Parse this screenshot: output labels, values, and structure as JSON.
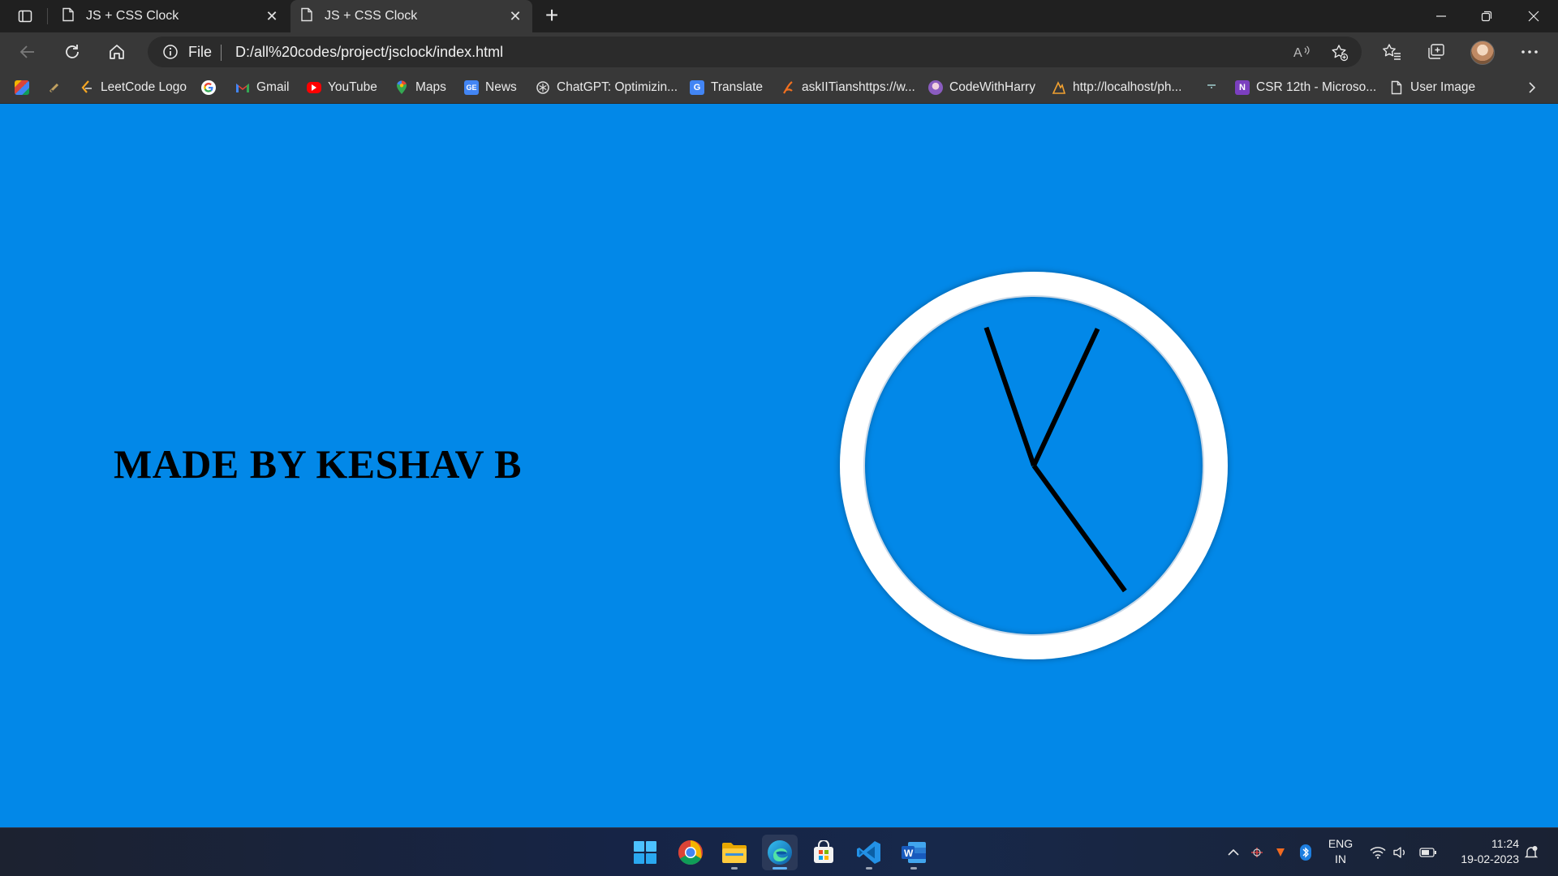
{
  "browser": {
    "tabs": [
      {
        "label": "JS + CSS Clock",
        "active": false
      },
      {
        "label": "JS + CSS Clock",
        "active": true
      }
    ],
    "address": {
      "scheme_label": "File",
      "url": "D:/all%20codes/project/jsclock/index.html"
    },
    "bookmarks": [
      {
        "label": "",
        "icon": "photos-icon"
      },
      {
        "label": "",
        "icon": "pen-icon"
      },
      {
        "label": "LeetCode Logo",
        "icon": "leetcode-icon"
      },
      {
        "label": "",
        "icon": "google-icon"
      },
      {
        "label": "Gmail",
        "icon": "gmail-icon"
      },
      {
        "label": "YouTube",
        "icon": "youtube-icon"
      },
      {
        "label": "Maps",
        "icon": "maps-icon"
      },
      {
        "label": "News",
        "icon": "news-icon"
      },
      {
        "label": "ChatGPT: Optimizin...",
        "icon": "chatgpt-icon"
      },
      {
        "label": "Translate",
        "icon": "translate-icon"
      },
      {
        "label": "askIITianshttps://w...",
        "icon": "askiitians-icon"
      },
      {
        "label": "CodeWithHarry",
        "icon": "codewithharry-icon"
      },
      {
        "label": "http://localhost/ph...",
        "icon": "xampp-icon"
      },
      {
        "label": "",
        "icon": "bookmark-icon"
      },
      {
        "label": "CSR 12th - Microso...",
        "icon": "onenote-icon"
      },
      {
        "label": "User Image",
        "icon": "document-icon"
      }
    ]
  },
  "page": {
    "heading": "MADE BY KESHAV B",
    "clock": {
      "hour_hand_angle_deg": 25,
      "minute_hand_angle_deg": -19,
      "second_hand_angle_deg": 144,
      "colors": {
        "background": "#0288e8",
        "rim": "#ffffff",
        "hands": "#000000"
      }
    }
  },
  "taskbar": {
    "apps": [
      {
        "name": "start",
        "icon": "windows-start-icon"
      },
      {
        "name": "chrome",
        "icon": "chrome-icon"
      },
      {
        "name": "file-explorer",
        "icon": "folder-icon"
      },
      {
        "name": "edge",
        "icon": "edge-icon"
      },
      {
        "name": "microsoft-store",
        "icon": "store-icon"
      },
      {
        "name": "vscode",
        "icon": "vscode-icon"
      },
      {
        "name": "word",
        "icon": "word-icon"
      }
    ],
    "tray": {
      "language_top": "ENG",
      "language_bottom": "IN",
      "time": "11:24",
      "date": "19-02-2023"
    }
  }
}
